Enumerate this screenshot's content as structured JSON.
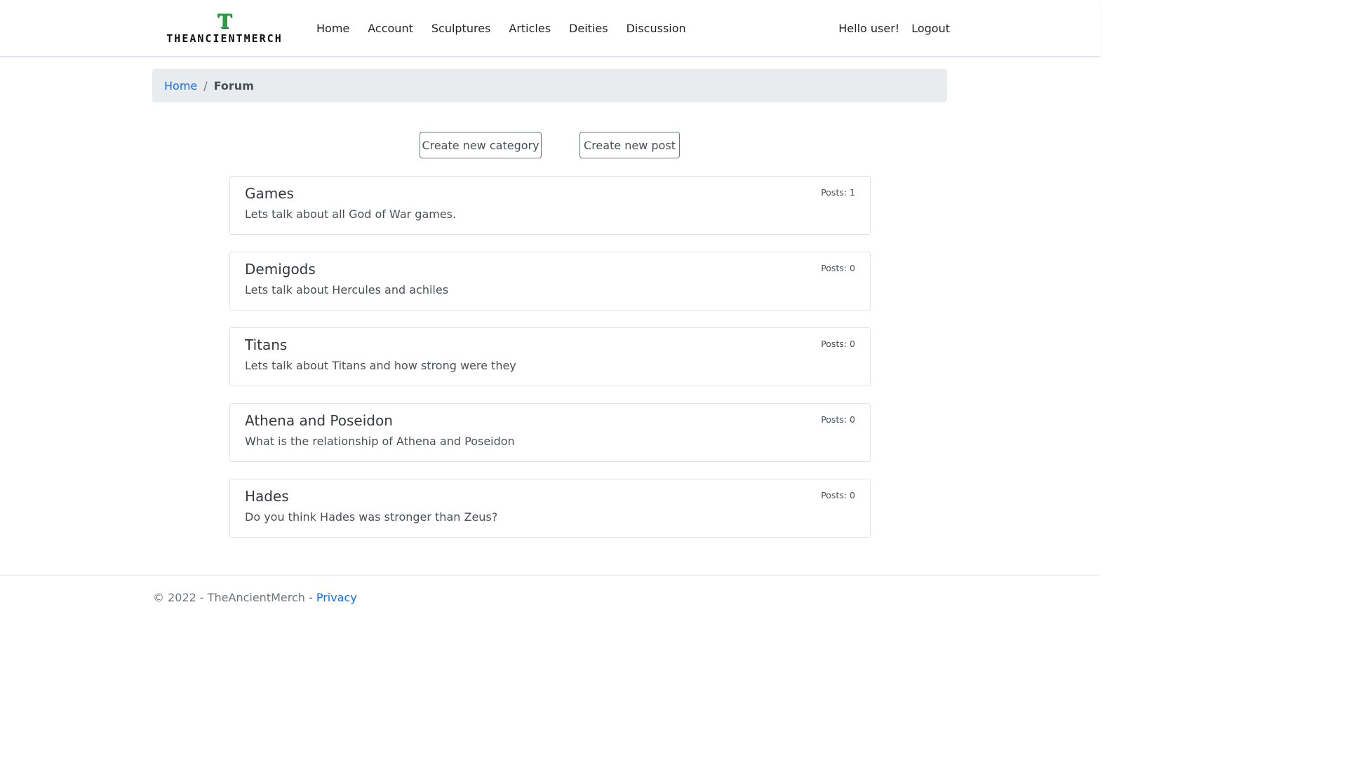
{
  "brand": {
    "logo_letter": "T",
    "logo_text": "THEANCIENTMERCH"
  },
  "nav": {
    "links": [
      "Home",
      "Account",
      "Sculptures",
      "Articles",
      "Deities",
      "Discussion"
    ],
    "greeting": "Hello user!",
    "logout": "Logout"
  },
  "breadcrumb": {
    "home": "Home",
    "separator": "/",
    "current": "Forum"
  },
  "actions": {
    "create_category": "Create new category",
    "create_post": "Create new post"
  },
  "categories": [
    {
      "title": "Games",
      "description": "Lets talk about all God of War games.",
      "posts": "Posts: 1"
    },
    {
      "title": "Demigods",
      "description": "Lets talk about Hercules and achiles",
      "posts": "Posts: 0"
    },
    {
      "title": "Titans",
      "description": "Lets talk about Titans and how strong were they",
      "posts": "Posts: 0"
    },
    {
      "title": "Athena and Poseidon",
      "description": "What is the relationship of Athena and Poseidon",
      "posts": "Posts: 0"
    },
    {
      "title": "Hades",
      "description": "Do you think Hades was stronger than Zeus?",
      "posts": "Posts: 0"
    }
  ],
  "footer": {
    "text": "© 2022 - TheAncientMerch - ",
    "privacy": "Privacy"
  },
  "colors": {
    "link": "#0d6efd",
    "logo_green": "#2e9e44",
    "breadcrumb_bg": "#e9ecef"
  }
}
